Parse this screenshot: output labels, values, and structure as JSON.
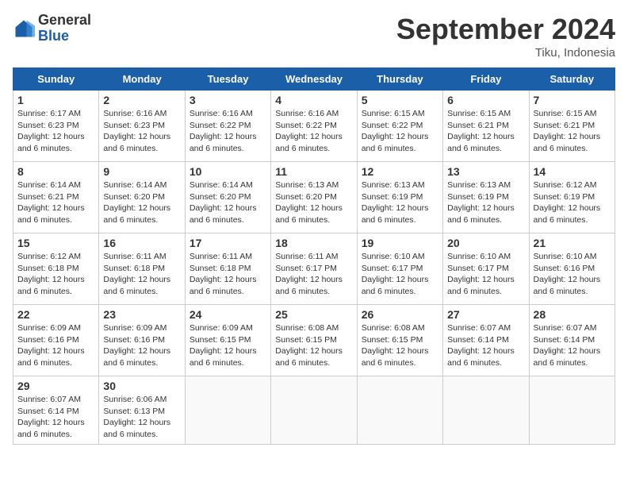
{
  "header": {
    "logo": {
      "general": "General",
      "blue": "Blue"
    },
    "title": "September 2024",
    "location": "Tiku, Indonesia"
  },
  "days_of_week": [
    "Sunday",
    "Monday",
    "Tuesday",
    "Wednesday",
    "Thursday",
    "Friday",
    "Saturday"
  ],
  "weeks": [
    [
      {
        "day": 1,
        "sunrise": "6:17 AM",
        "sunset": "6:23 PM",
        "daylight": "12 hours and 6 minutes."
      },
      {
        "day": 2,
        "sunrise": "6:16 AM",
        "sunset": "6:23 PM",
        "daylight": "12 hours and 6 minutes."
      },
      {
        "day": 3,
        "sunrise": "6:16 AM",
        "sunset": "6:22 PM",
        "daylight": "12 hours and 6 minutes."
      },
      {
        "day": 4,
        "sunrise": "6:16 AM",
        "sunset": "6:22 PM",
        "daylight": "12 hours and 6 minutes."
      },
      {
        "day": 5,
        "sunrise": "6:15 AM",
        "sunset": "6:22 PM",
        "daylight": "12 hours and 6 minutes."
      },
      {
        "day": 6,
        "sunrise": "6:15 AM",
        "sunset": "6:21 PM",
        "daylight": "12 hours and 6 minutes."
      },
      {
        "day": 7,
        "sunrise": "6:15 AM",
        "sunset": "6:21 PM",
        "daylight": "12 hours and 6 minutes."
      }
    ],
    [
      {
        "day": 8,
        "sunrise": "6:14 AM",
        "sunset": "6:21 PM",
        "daylight": "12 hours and 6 minutes."
      },
      {
        "day": 9,
        "sunrise": "6:14 AM",
        "sunset": "6:20 PM",
        "daylight": "12 hours and 6 minutes."
      },
      {
        "day": 10,
        "sunrise": "6:14 AM",
        "sunset": "6:20 PM",
        "daylight": "12 hours and 6 minutes."
      },
      {
        "day": 11,
        "sunrise": "6:13 AM",
        "sunset": "6:20 PM",
        "daylight": "12 hours and 6 minutes."
      },
      {
        "day": 12,
        "sunrise": "6:13 AM",
        "sunset": "6:19 PM",
        "daylight": "12 hours and 6 minutes."
      },
      {
        "day": 13,
        "sunrise": "6:13 AM",
        "sunset": "6:19 PM",
        "daylight": "12 hours and 6 minutes."
      },
      {
        "day": 14,
        "sunrise": "6:12 AM",
        "sunset": "6:19 PM",
        "daylight": "12 hours and 6 minutes."
      }
    ],
    [
      {
        "day": 15,
        "sunrise": "6:12 AM",
        "sunset": "6:18 PM",
        "daylight": "12 hours and 6 minutes."
      },
      {
        "day": 16,
        "sunrise": "6:11 AM",
        "sunset": "6:18 PM",
        "daylight": "12 hours and 6 minutes."
      },
      {
        "day": 17,
        "sunrise": "6:11 AM",
        "sunset": "6:18 PM",
        "daylight": "12 hours and 6 minutes."
      },
      {
        "day": 18,
        "sunrise": "6:11 AM",
        "sunset": "6:17 PM",
        "daylight": "12 hours and 6 minutes."
      },
      {
        "day": 19,
        "sunrise": "6:10 AM",
        "sunset": "6:17 PM",
        "daylight": "12 hours and 6 minutes."
      },
      {
        "day": 20,
        "sunrise": "6:10 AM",
        "sunset": "6:17 PM",
        "daylight": "12 hours and 6 minutes."
      },
      {
        "day": 21,
        "sunrise": "6:10 AM",
        "sunset": "6:16 PM",
        "daylight": "12 hours and 6 minutes."
      }
    ],
    [
      {
        "day": 22,
        "sunrise": "6:09 AM",
        "sunset": "6:16 PM",
        "daylight": "12 hours and 6 minutes."
      },
      {
        "day": 23,
        "sunrise": "6:09 AM",
        "sunset": "6:16 PM",
        "daylight": "12 hours and 6 minutes."
      },
      {
        "day": 24,
        "sunrise": "6:09 AM",
        "sunset": "6:15 PM",
        "daylight": "12 hours and 6 minutes."
      },
      {
        "day": 25,
        "sunrise": "6:08 AM",
        "sunset": "6:15 PM",
        "daylight": "12 hours and 6 minutes."
      },
      {
        "day": 26,
        "sunrise": "6:08 AM",
        "sunset": "6:15 PM",
        "daylight": "12 hours and 6 minutes."
      },
      {
        "day": 27,
        "sunrise": "6:07 AM",
        "sunset": "6:14 PM",
        "daylight": "12 hours and 6 minutes."
      },
      {
        "day": 28,
        "sunrise": "6:07 AM",
        "sunset": "6:14 PM",
        "daylight": "12 hours and 6 minutes."
      }
    ],
    [
      {
        "day": 29,
        "sunrise": "6:07 AM",
        "sunset": "6:14 PM",
        "daylight": "12 hours and 6 minutes."
      },
      {
        "day": 30,
        "sunrise": "6:06 AM",
        "sunset": "6:13 PM",
        "daylight": "12 hours and 6 minutes."
      },
      null,
      null,
      null,
      null,
      null
    ]
  ]
}
